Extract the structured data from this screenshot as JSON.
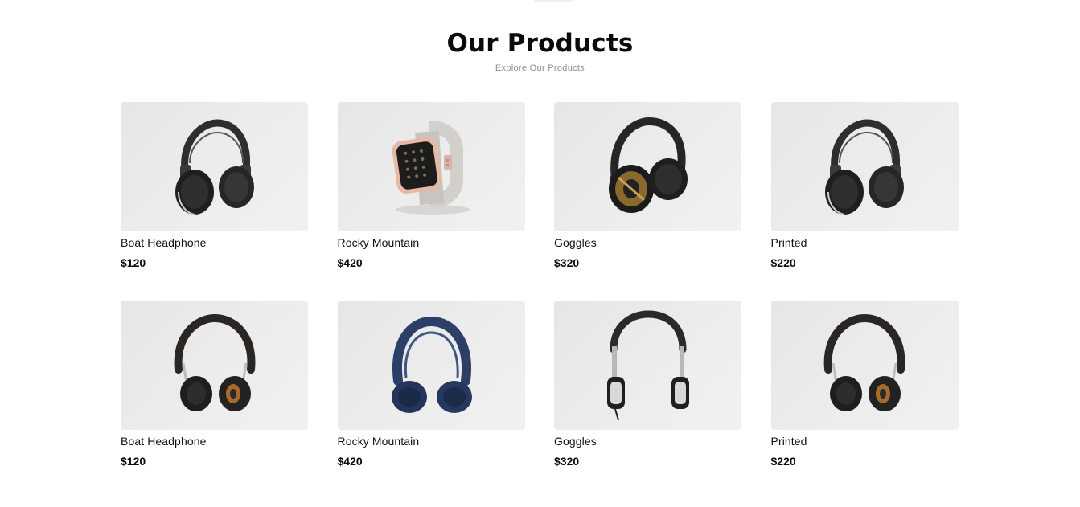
{
  "section": {
    "title": "Our Products",
    "subtitle": "Explore Our Products"
  },
  "products": [
    {
      "name": "Boat Headphone",
      "price": "$120",
      "image_icon": "headphone-dark-icon"
    },
    {
      "name": "Rocky Mountain",
      "price": "$420",
      "image_icon": "smartwatch-icon"
    },
    {
      "name": "Goggles",
      "price": "$320",
      "image_icon": "headphone-gold-icon"
    },
    {
      "name": "Printed",
      "price": "$220",
      "image_icon": "headphone-dark-icon"
    },
    {
      "name": "Boat Headphone",
      "price": "$120",
      "image_icon": "headphone-leather-icon"
    },
    {
      "name": "Rocky Mountain",
      "price": "$420",
      "image_icon": "headphone-blue-icon"
    },
    {
      "name": "Goggles",
      "price": "$320",
      "image_icon": "headphone-dj-icon"
    },
    {
      "name": "Printed",
      "price": "$220",
      "image_icon": "headphone-leather-icon"
    }
  ]
}
